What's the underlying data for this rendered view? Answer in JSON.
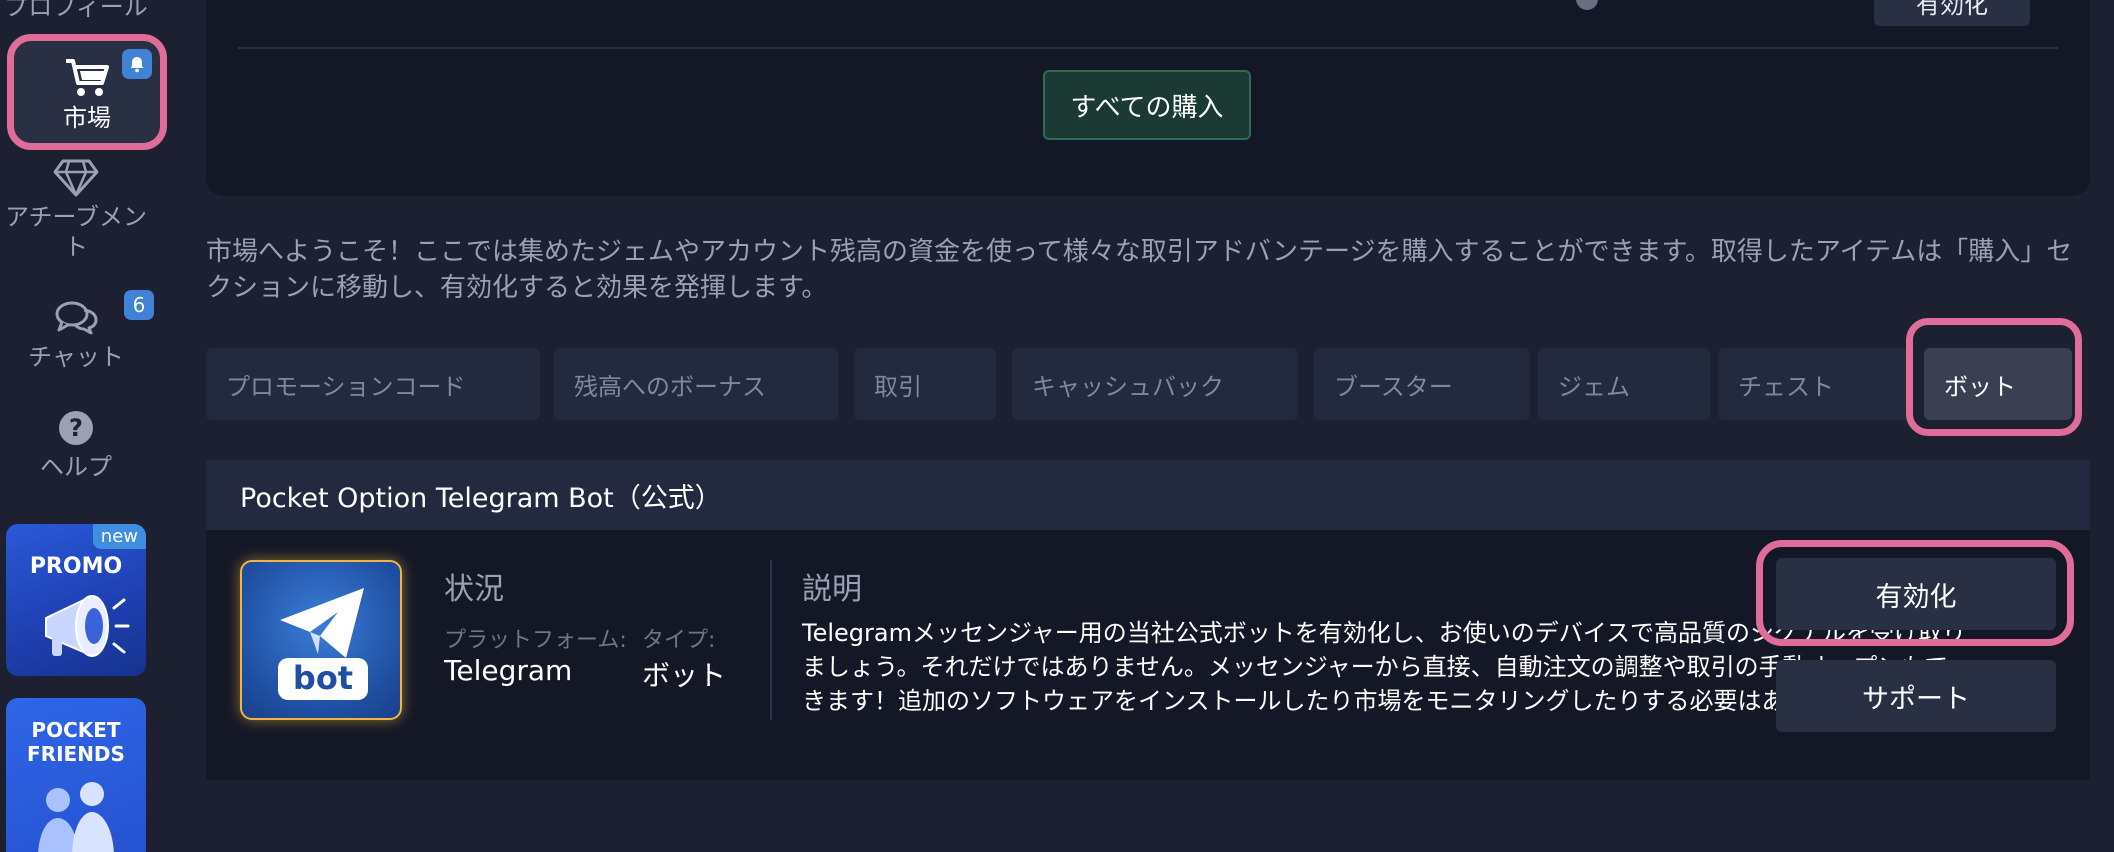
{
  "sidebar": {
    "profile_label": "プロフィール",
    "items": [
      {
        "label": "市場",
        "icon": "cart-icon"
      },
      {
        "label": "アチーブメント",
        "icon": "diamond-icon"
      },
      {
        "label": "チャット",
        "icon": "chat-icon",
        "badge": "6"
      },
      {
        "label": "ヘルプ",
        "icon": "help-icon"
      }
    ],
    "promo": {
      "title": "PROMO",
      "badge": "new"
    },
    "friends": {
      "title_line1": "POCKET",
      "title_line2": "FRIENDS"
    }
  },
  "top_panel": {
    "activate_label": "有効化",
    "all_purchases_label": "すべての購入"
  },
  "intro_text": "市場へようこそ！ここでは集めたジェムやアカウント残高の資金を使って様々な取引アドバンテージを購入することができます。取得したアイテムは「購入」セクションに移動し、有効化すると効果を発揮します。",
  "tabs": [
    {
      "label": "プロモーションコード"
    },
    {
      "label": "残高へのボーナス"
    },
    {
      "label": "取引"
    },
    {
      "label": "キャッシュバック"
    },
    {
      "label": "ブースター"
    },
    {
      "label": "ジェム"
    },
    {
      "label": "チェスト"
    },
    {
      "label": "ボット"
    }
  ],
  "active_tab": "ボット",
  "card": {
    "title": "Pocket Option Telegram Bot（公式）",
    "icon_text": "bot",
    "status_title": "状況",
    "platform_label": "プラットフォーム:",
    "platform_value": "Telegram",
    "type_label": "タイプ:",
    "type_value": "ボット",
    "description_title": "説明",
    "description": "Telegramメッセンジャー用の当社公式ボットを有効化し、お使いのデバイスで高品質のシグナルを受け取りましょう。それだけではありません。メッセンジャーから直接、自動注文の調整や取引の手動オープンもできます！追加のソフトウェアをインストールしたり市場をモニタリングしたりする必要はありません。",
    "activate_label": "有効化",
    "support_label": "サポート"
  },
  "colors": {
    "background": "#1c2030",
    "panel": "#141826",
    "highlight": "#e06c99",
    "badge": "#3f82d6"
  }
}
